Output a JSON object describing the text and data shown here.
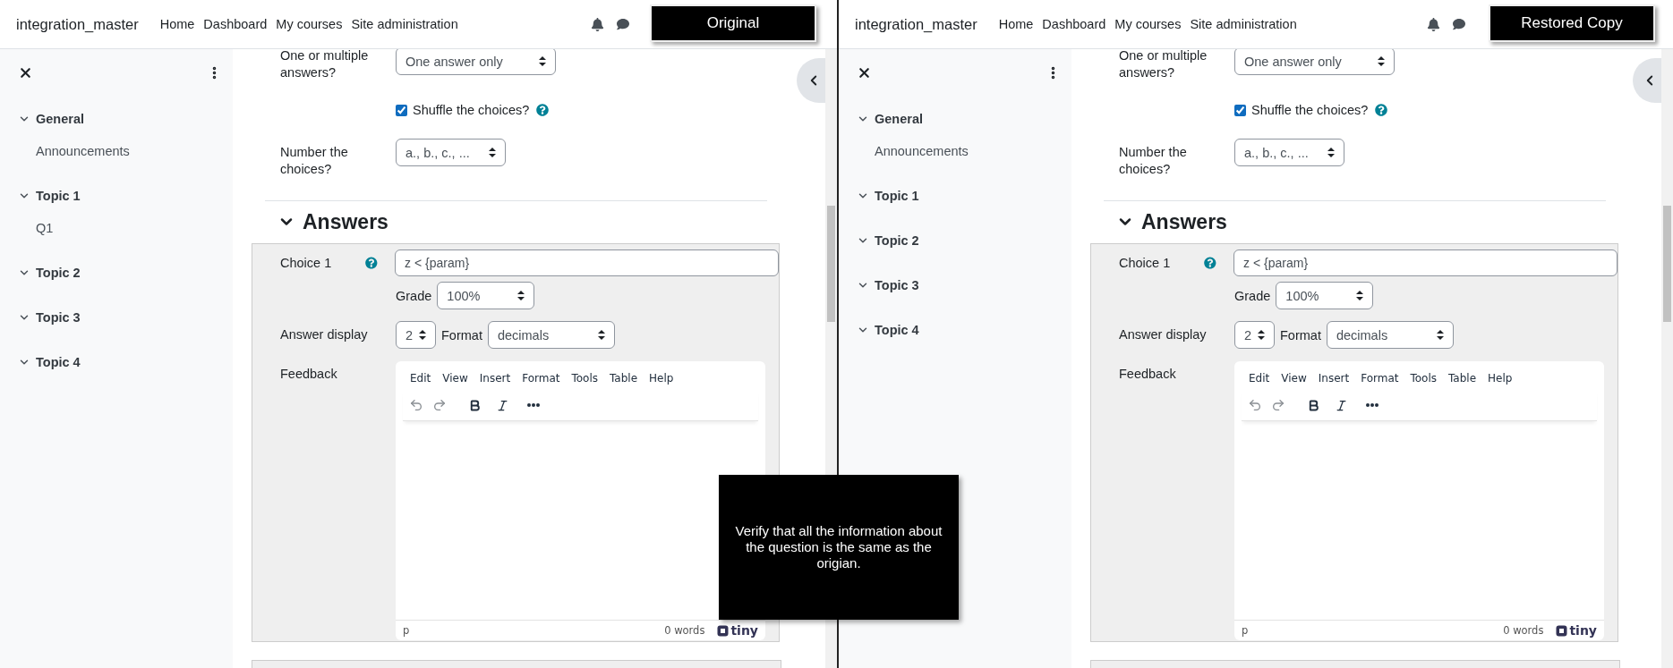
{
  "panes": [
    {
      "label": "Original",
      "navbar": {
        "brand": "integration_master",
        "links": [
          "Home",
          "Dashboard",
          "My courses",
          "Site administration"
        ]
      },
      "sidebar": {
        "sections": [
          {
            "label": "General",
            "children": [
              {
                "label": "Announcements"
              }
            ]
          },
          {
            "label": "Topic 1",
            "children": [
              {
                "label": "Q1"
              }
            ]
          },
          {
            "label": "Topic 2"
          },
          {
            "label": "Topic 3"
          },
          {
            "label": "Topic 4"
          }
        ]
      },
      "form": {
        "single": {
          "label": "One or multiple answers?",
          "value": "One answer only"
        },
        "shuffle": {
          "label": "Shuffle the choices?",
          "checked": true
        },
        "numbering": {
          "label": "Number the choices?",
          "value": "a., b., c., ..."
        },
        "answers": {
          "title": "Answers",
          "choice": {
            "label": "Choice 1",
            "value": "z < {param}"
          },
          "grade": {
            "label": "Grade",
            "value": "100%"
          },
          "display": {
            "label": "Answer display",
            "value": "2"
          },
          "format": {
            "label": "Format",
            "value": "decimals"
          },
          "feedback": {
            "label": "Feedback",
            "menu": [
              "Edit",
              "View",
              "Insert",
              "Format",
              "Tools",
              "Table",
              "Help"
            ],
            "status": "p",
            "words": "0 words",
            "brand": "tiny"
          }
        }
      }
    },
    {
      "label": "Restored Copy",
      "navbar": {
        "brand": "integration_master",
        "links": [
          "Home",
          "Dashboard",
          "My courses",
          "Site administration"
        ]
      },
      "sidebar": {
        "sections": [
          {
            "label": "General",
            "children": [
              {
                "label": "Announcements"
              }
            ]
          },
          {
            "label": "Topic 1"
          },
          {
            "label": "Topic 2"
          },
          {
            "label": "Topic 3"
          },
          {
            "label": "Topic 4"
          }
        ]
      },
      "form": {
        "single": {
          "label": "One or multiple answers?",
          "value": "One answer only"
        },
        "shuffle": {
          "label": "Shuffle the choices?",
          "checked": true
        },
        "numbering": {
          "label": "Number the choices?",
          "value": "a., b., c., ..."
        },
        "answers": {
          "title": "Answers",
          "choice": {
            "label": "Choice 1",
            "value": "z < {param}"
          },
          "grade": {
            "label": "Grade",
            "value": "100%"
          },
          "display": {
            "label": "Answer display",
            "value": "2"
          },
          "format": {
            "label": "Format",
            "value": "decimals"
          },
          "feedback": {
            "label": "Feedback",
            "menu": [
              "Edit",
              "View",
              "Insert",
              "Format",
              "Tools",
              "Table",
              "Help"
            ],
            "status": "p",
            "words": "0 words",
            "brand": "tiny"
          }
        }
      }
    }
  ],
  "caption": "Verify that all the information about the question is the same as the origian."
}
